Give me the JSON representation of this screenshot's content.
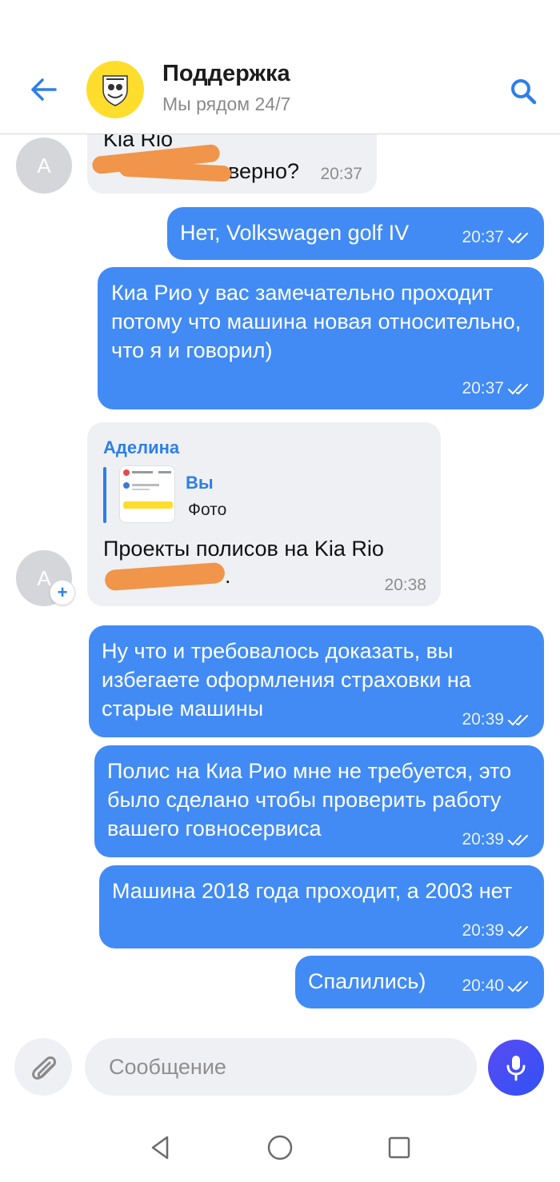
{
  "header": {
    "title": "Поддержка",
    "subtitle": "Мы рядом 24/7",
    "back_icon": "arrow-left-icon",
    "search_icon": "search-icon",
    "logo_icon": "tinkoff-crest-icon"
  },
  "messages": [
    {
      "from": "support",
      "avatar_letter": "A",
      "lines": [
        "Kia Rio",
        "верно?"
      ],
      "time": "20:37"
    },
    {
      "from": "me",
      "text": "Нет, Volkswagen golf IV",
      "time": "20:37"
    },
    {
      "from": "me",
      "text": "Киа Рио у вас замечательно проходит потому что машина новая относительно, что я и говорил)",
      "time": "20:37"
    },
    {
      "from": "support",
      "sender": "Аделина",
      "avatar_letter": "A",
      "reply": {
        "author": "Вы",
        "preview": "Фото"
      },
      "text": "Проекты полисов на Kia Rio",
      "time": "20:38"
    },
    {
      "from": "me",
      "text": "Ну что и требовалось доказать, вы избегаете оформления страховки на старые машины",
      "time": "20:39"
    },
    {
      "from": "me",
      "text": "Полис на Киа Рио мне не требуется, это было сделано чтобы проверить работу вашего говносервиса",
      "time": "20:39"
    },
    {
      "from": "me",
      "text": "Машина 2018 года проходит, а 2003 нет",
      "time": "20:39"
    },
    {
      "from": "me",
      "text": "Спалились)",
      "time": "20:40"
    }
  ],
  "input": {
    "placeholder": "Сообщение"
  },
  "colors": {
    "accent": "#428bf4",
    "incoming": "#eef0f3",
    "logo": "#ffdd2d",
    "redaction": "#f0954a"
  },
  "navbar": {
    "icons": [
      "back-triangle-icon",
      "home-circle-icon",
      "recents-square-icon"
    ]
  }
}
